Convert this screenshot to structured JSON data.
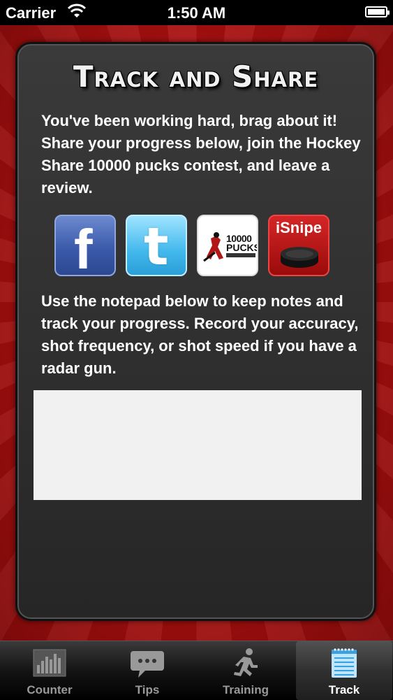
{
  "status_bar": {
    "carrier": "Carrier",
    "time": "1:50 AM"
  },
  "card": {
    "title": "Track and Share",
    "intro": "You've been working hard, brag about it! Share your progress below, join the Hockey Share 10000 pucks contest, and leave a review.",
    "share_buttons": [
      {
        "name": "facebook",
        "icon": "facebook-icon",
        "glyph": "f"
      },
      {
        "name": "twitter",
        "icon": "twitter-icon",
        "glyph": "t"
      },
      {
        "name": "10000-pucks",
        "icon": "10000-pucks-logo",
        "number": "10000",
        "word": "PUCKS"
      },
      {
        "name": "isnipe",
        "icon": "isnipe-logo",
        "word": "iSnipe"
      }
    ],
    "notes_instructions": "Use the notepad below to keep notes and track your progress. Record your accuracy, shot frequency, or shot speed if you have a radar gun.",
    "notepad_value": ""
  },
  "tab_bar": {
    "tabs": [
      {
        "label": "Counter",
        "icon": "bar-chart-icon",
        "active": false
      },
      {
        "label": "Tips",
        "icon": "speech-bubble-icon",
        "active": false
      },
      {
        "label": "Training",
        "icon": "running-man-icon",
        "active": false
      },
      {
        "label": "Track",
        "icon": "notepad-icon",
        "active": true
      }
    ]
  },
  "colors": {
    "background_red": "#d21d1d",
    "card_bg": "#2e2e2e",
    "active_tab_text": "#ffffff",
    "inactive_tab_text": "#999999"
  }
}
